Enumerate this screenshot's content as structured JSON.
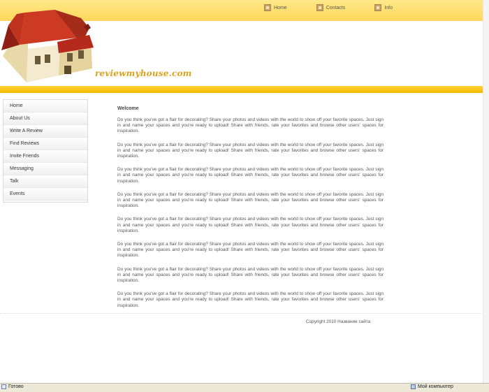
{
  "topnav": [
    {
      "label": "Home",
      "icon": "home-icon"
    },
    {
      "label": "Contacts",
      "icon": "contacts-icon"
    },
    {
      "label": "Info",
      "icon": "info-icon"
    }
  ],
  "logo": {
    "text": "reviewmyhouse.com"
  },
  "sidebar": {
    "items": [
      {
        "label": "Home"
      },
      {
        "label": "About Us"
      },
      {
        "label": "Write A Review"
      },
      {
        "label": "Find Reviews"
      },
      {
        "label": "Invite Friends"
      },
      {
        "label": "Messaging"
      },
      {
        "label": "Talk"
      },
      {
        "label": "Events"
      }
    ]
  },
  "main": {
    "title": "Welcome",
    "paragraphs": [
      "Do you think you've got a flair for decorating? Share your photos and videos with the world to show off your favorite spaces. Just sign in and name your spaces and you're ready to upload! Share with friends, rate your favorites and browse other users' spaces for inspiration.",
      "Do you think you've got a flair for decorating? Share your photos and videos with the world to show off your favorite spaces. Just sign in and name your spaces and you're ready to upload! Share with friends, rate your favorites and browse other users' spaces for inspiration.",
      "Do you think you've got a flair for decorating? Share your photos and videos with the world to show off your favorite spaces. Just sign in and name your spaces and you're ready to upload! Share with friends, rate your favorites and browse other users' spaces for inspiration.",
      "Do you think you've got a flair for decorating? Share your photos and videos with the world to show off your favorite spaces. Just sign in and name your spaces and you're ready to upload! Share with friends, rate your favorites and browse other users' spaces for inspiration.",
      "Do you think you've got a flair for decorating? Share your photos and videos with the world to show off your favorite spaces. Just sign in and name your spaces and you're ready to upload! Share with friends, rate your favorites and browse other users' spaces for inspiration.",
      "Do you think you've got a flair for decorating? Share your photos and videos with the world to show off your favorite spaces. Just sign in and name your spaces and you're ready to upload! Share with friends, rate your favorites and browse other users' spaces for inspiration.",
      "Do you think you've got a flair for decorating? Share your photos and videos with the world to show off your favorite spaces. Just sign in and name your spaces and you're ready to upload! Share with friends, rate your favorites and browse other users' spaces for inspiration.",
      "Do you think you've got a flair for decorating? Share your photos and videos with the world to show off your favorite spaces. Just sign in and name your spaces and you're ready to upload! Share with friends, rate your favorites and browse other users' spaces for inspiration."
    ]
  },
  "footer": {
    "text": "Copyright 2010 Название сайта"
  },
  "statusbar": {
    "left": "Готово",
    "right": "Мой компьютер"
  },
  "colors": {
    "topbar": "#ffd65a",
    "strip": "#f7b900",
    "roof": "#b52a1c",
    "logo": "#d9a41c"
  }
}
